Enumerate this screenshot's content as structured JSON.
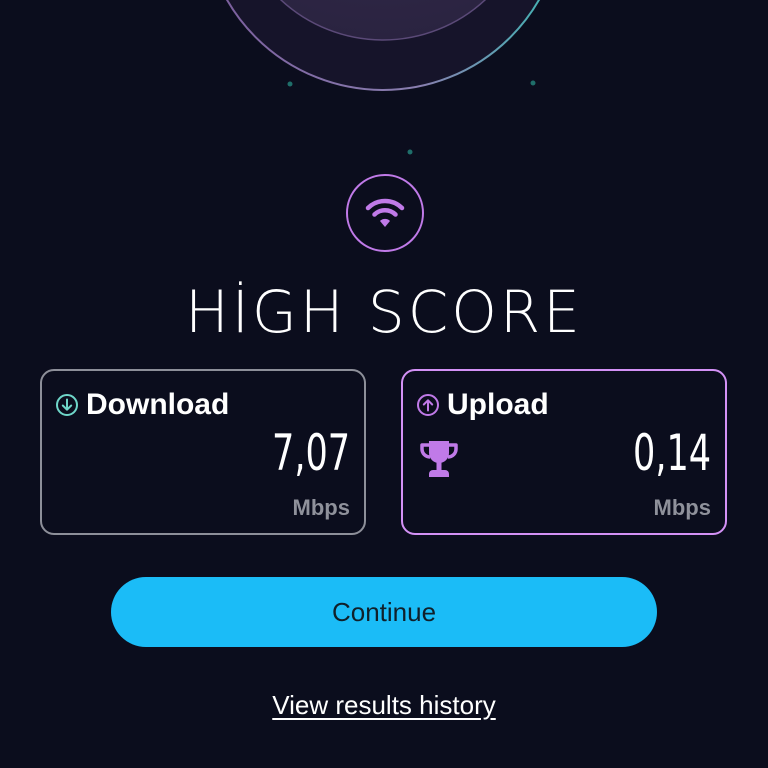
{
  "score": {
    "title": "HİGH SCORE"
  },
  "download": {
    "label": "Download",
    "value": "7,07",
    "unit": "Mbps",
    "icon": "arrow-down-circle-icon",
    "accent": "#6fd6c9"
  },
  "upload": {
    "label": "Upload",
    "value": "0,14",
    "unit": "Mbps",
    "icon": "arrow-up-circle-icon",
    "badge_icon": "trophy-icon",
    "accent": "#c07ae8"
  },
  "actions": {
    "continue_label": "Continue",
    "history_label": "View results history"
  },
  "colors": {
    "background": "#0b0d1d",
    "button": "#1bbcf7",
    "wifi_accent": "#c07ae8"
  }
}
